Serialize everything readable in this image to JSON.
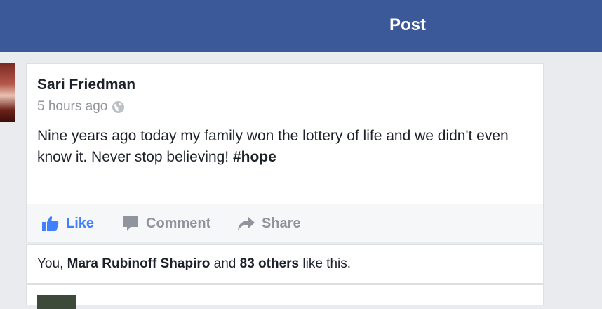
{
  "header": {
    "title": "Post"
  },
  "post": {
    "author": "Sari Friedman",
    "time": "5 hours ago",
    "privacy_icon": "globe-icon",
    "text": "Nine years ago today my family won the lottery of life and we didn't even know it.  Never stop believing! ",
    "hashtag": "#hope"
  },
  "actions": {
    "like_label": "Like",
    "comment_label": "Comment",
    "share_label": "Share"
  },
  "likes": {
    "prefix": "You, ",
    "name": "Mara Rubinoff Shapiro",
    "middle": " and ",
    "others": "83 others",
    "suffix": " like this."
  },
  "colors": {
    "brand": "#3b5998",
    "like_accent": "#4080ff",
    "muted": "#90949c",
    "background": "#e9ebee"
  }
}
